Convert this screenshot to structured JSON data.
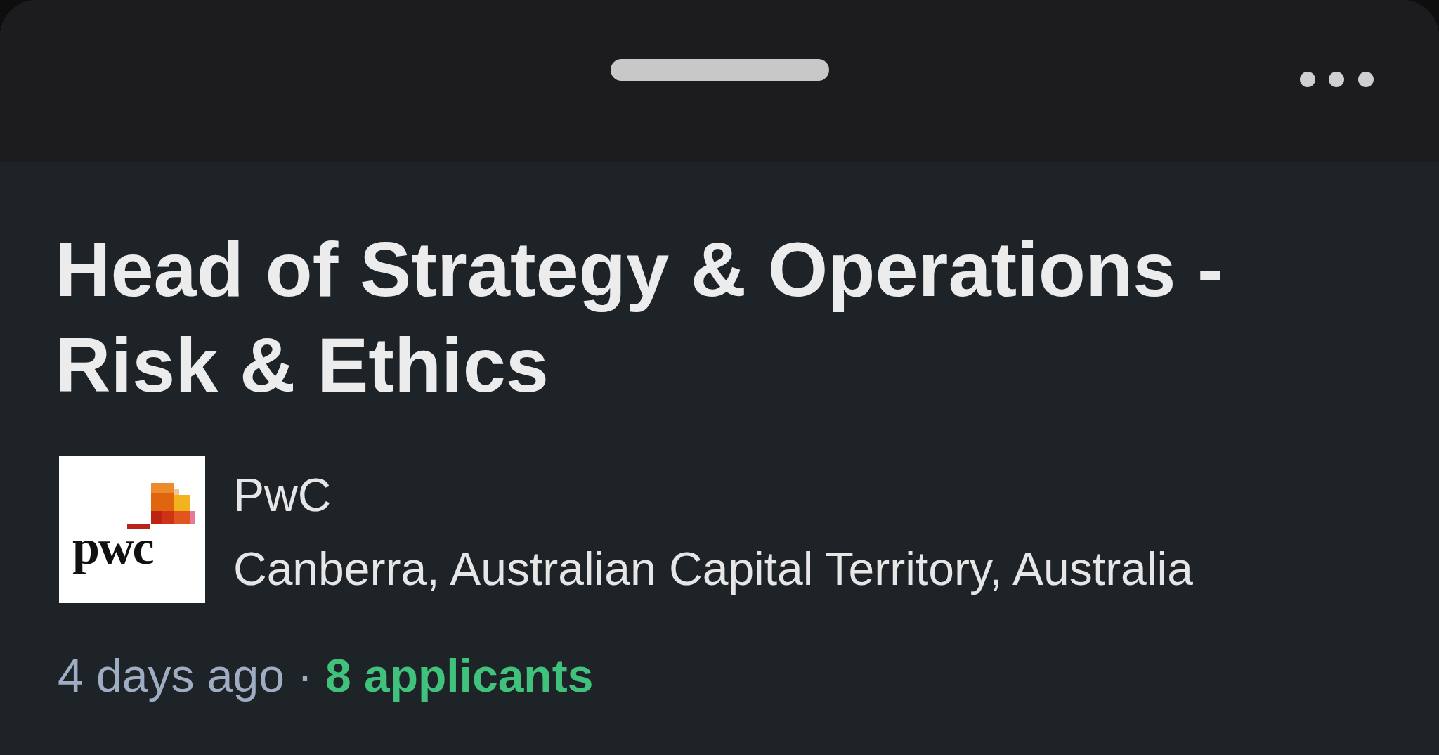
{
  "job": {
    "title": "Head of Strategy & Operations - Risk & Ethics",
    "company": {
      "name": "PwC",
      "logo_text": "pwc"
    },
    "location": "Canberra, Australian Capital Territory, Australia",
    "posted": "4 days ago",
    "separator": "·",
    "applicants": "8 applicants"
  }
}
